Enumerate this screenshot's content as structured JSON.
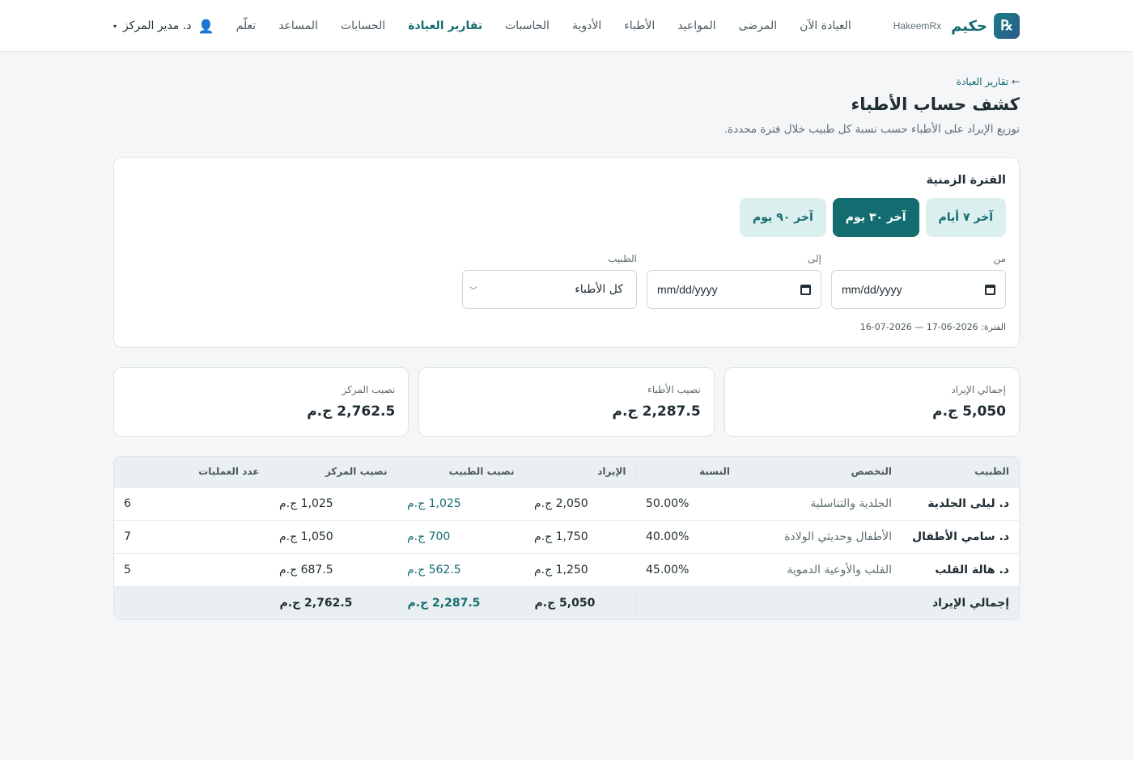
{
  "brand": {
    "name": "حكيم",
    "sub": "HakeemRx",
    "logo": "℞"
  },
  "nav": [
    {
      "label": "العيادة الآن",
      "active": false
    },
    {
      "label": "المرضى",
      "active": false
    },
    {
      "label": "المواعيد",
      "active": false
    },
    {
      "label": "الأطباء",
      "active": false
    },
    {
      "label": "الأدوية",
      "active": false
    },
    {
      "label": "الحاسبات",
      "active": false
    },
    {
      "label": "تقارير العيادة",
      "active": true
    },
    {
      "label": "الحسابات",
      "active": false
    },
    {
      "label": "المساعد",
      "active": false
    },
    {
      "label": "تعلّم",
      "active": false
    }
  ],
  "user": {
    "name": "د. مدير المركز",
    "caret": "▾",
    "icon": "👤"
  },
  "breadcrumb": {
    "arrow": "←",
    "label": "تقارير العيادة"
  },
  "page": {
    "title": "كشف حساب الأطباء",
    "subtitle": "توزيع الإيراد على الأطباء حسب نسبة كل طبيب خلال فترة محددة."
  },
  "period": {
    "title": "الفترة الزمنية",
    "buttons": [
      {
        "label": "آخر ٧ أيام",
        "active": false
      },
      {
        "label": "آخر ٣٠ يوم",
        "active": true
      },
      {
        "label": "آخر ٩٠ يوم",
        "active": false
      }
    ],
    "from_label": "من",
    "from_value": "mm/dd/yyyy",
    "to_label": "إلى",
    "to_value": "mm/dd/yyyy",
    "doctor_label": "الطبيب",
    "doctor_value": "كل الأطباء",
    "range_note": "الفترة: 2026-06-17 — 2026-07-16"
  },
  "stats": [
    {
      "label": "إجمالي الإيراد",
      "value": "5,050 ج.م"
    },
    {
      "label": "نصيب الأطباء",
      "value": "2,287.5 ج.م"
    },
    {
      "label": "نصيب المركز",
      "value": "2,762.5 ج.م"
    }
  ],
  "table": {
    "headers": [
      "الطبيب",
      "التخصص",
      "النسبة",
      "الإيراد",
      "نصيب الطبيب",
      "نصيب المركز",
      "عدد العمليات"
    ],
    "rows": [
      {
        "doctor": "د. ليلى الجلدية",
        "specialty": "الجلدية والتناسلية",
        "ratio": "50.00%",
        "revenue": "2,050 ج.م",
        "doctor_share": "1,025 ج.م",
        "center_share": "1,025 ج.م",
        "ops": "6"
      },
      {
        "doctor": "د. سامي الأطفال",
        "specialty": "الأطفال وحديثي الولادة",
        "ratio": "40.00%",
        "revenue": "1,750 ج.م",
        "doctor_share": "700 ج.م",
        "center_share": "1,050 ج.م",
        "ops": "7"
      },
      {
        "doctor": "د. هالة القلب",
        "specialty": "القلب والأوعية الدموية",
        "ratio": "45.00%",
        "revenue": "1,250 ج.م",
        "doctor_share": "562.5 ج.م",
        "center_share": "687.5 ج.م",
        "ops": "5"
      }
    ],
    "total": {
      "label": "إجمالي الإيراد",
      "revenue": "5,050 ج.م",
      "doctor_share": "2,287.5 ج.م",
      "center_share": "2,762.5 ج.م"
    }
  },
  "colors": {
    "accent": "#136c70",
    "accent_light": "#dcefef",
    "background": "#f4f6f7"
  }
}
